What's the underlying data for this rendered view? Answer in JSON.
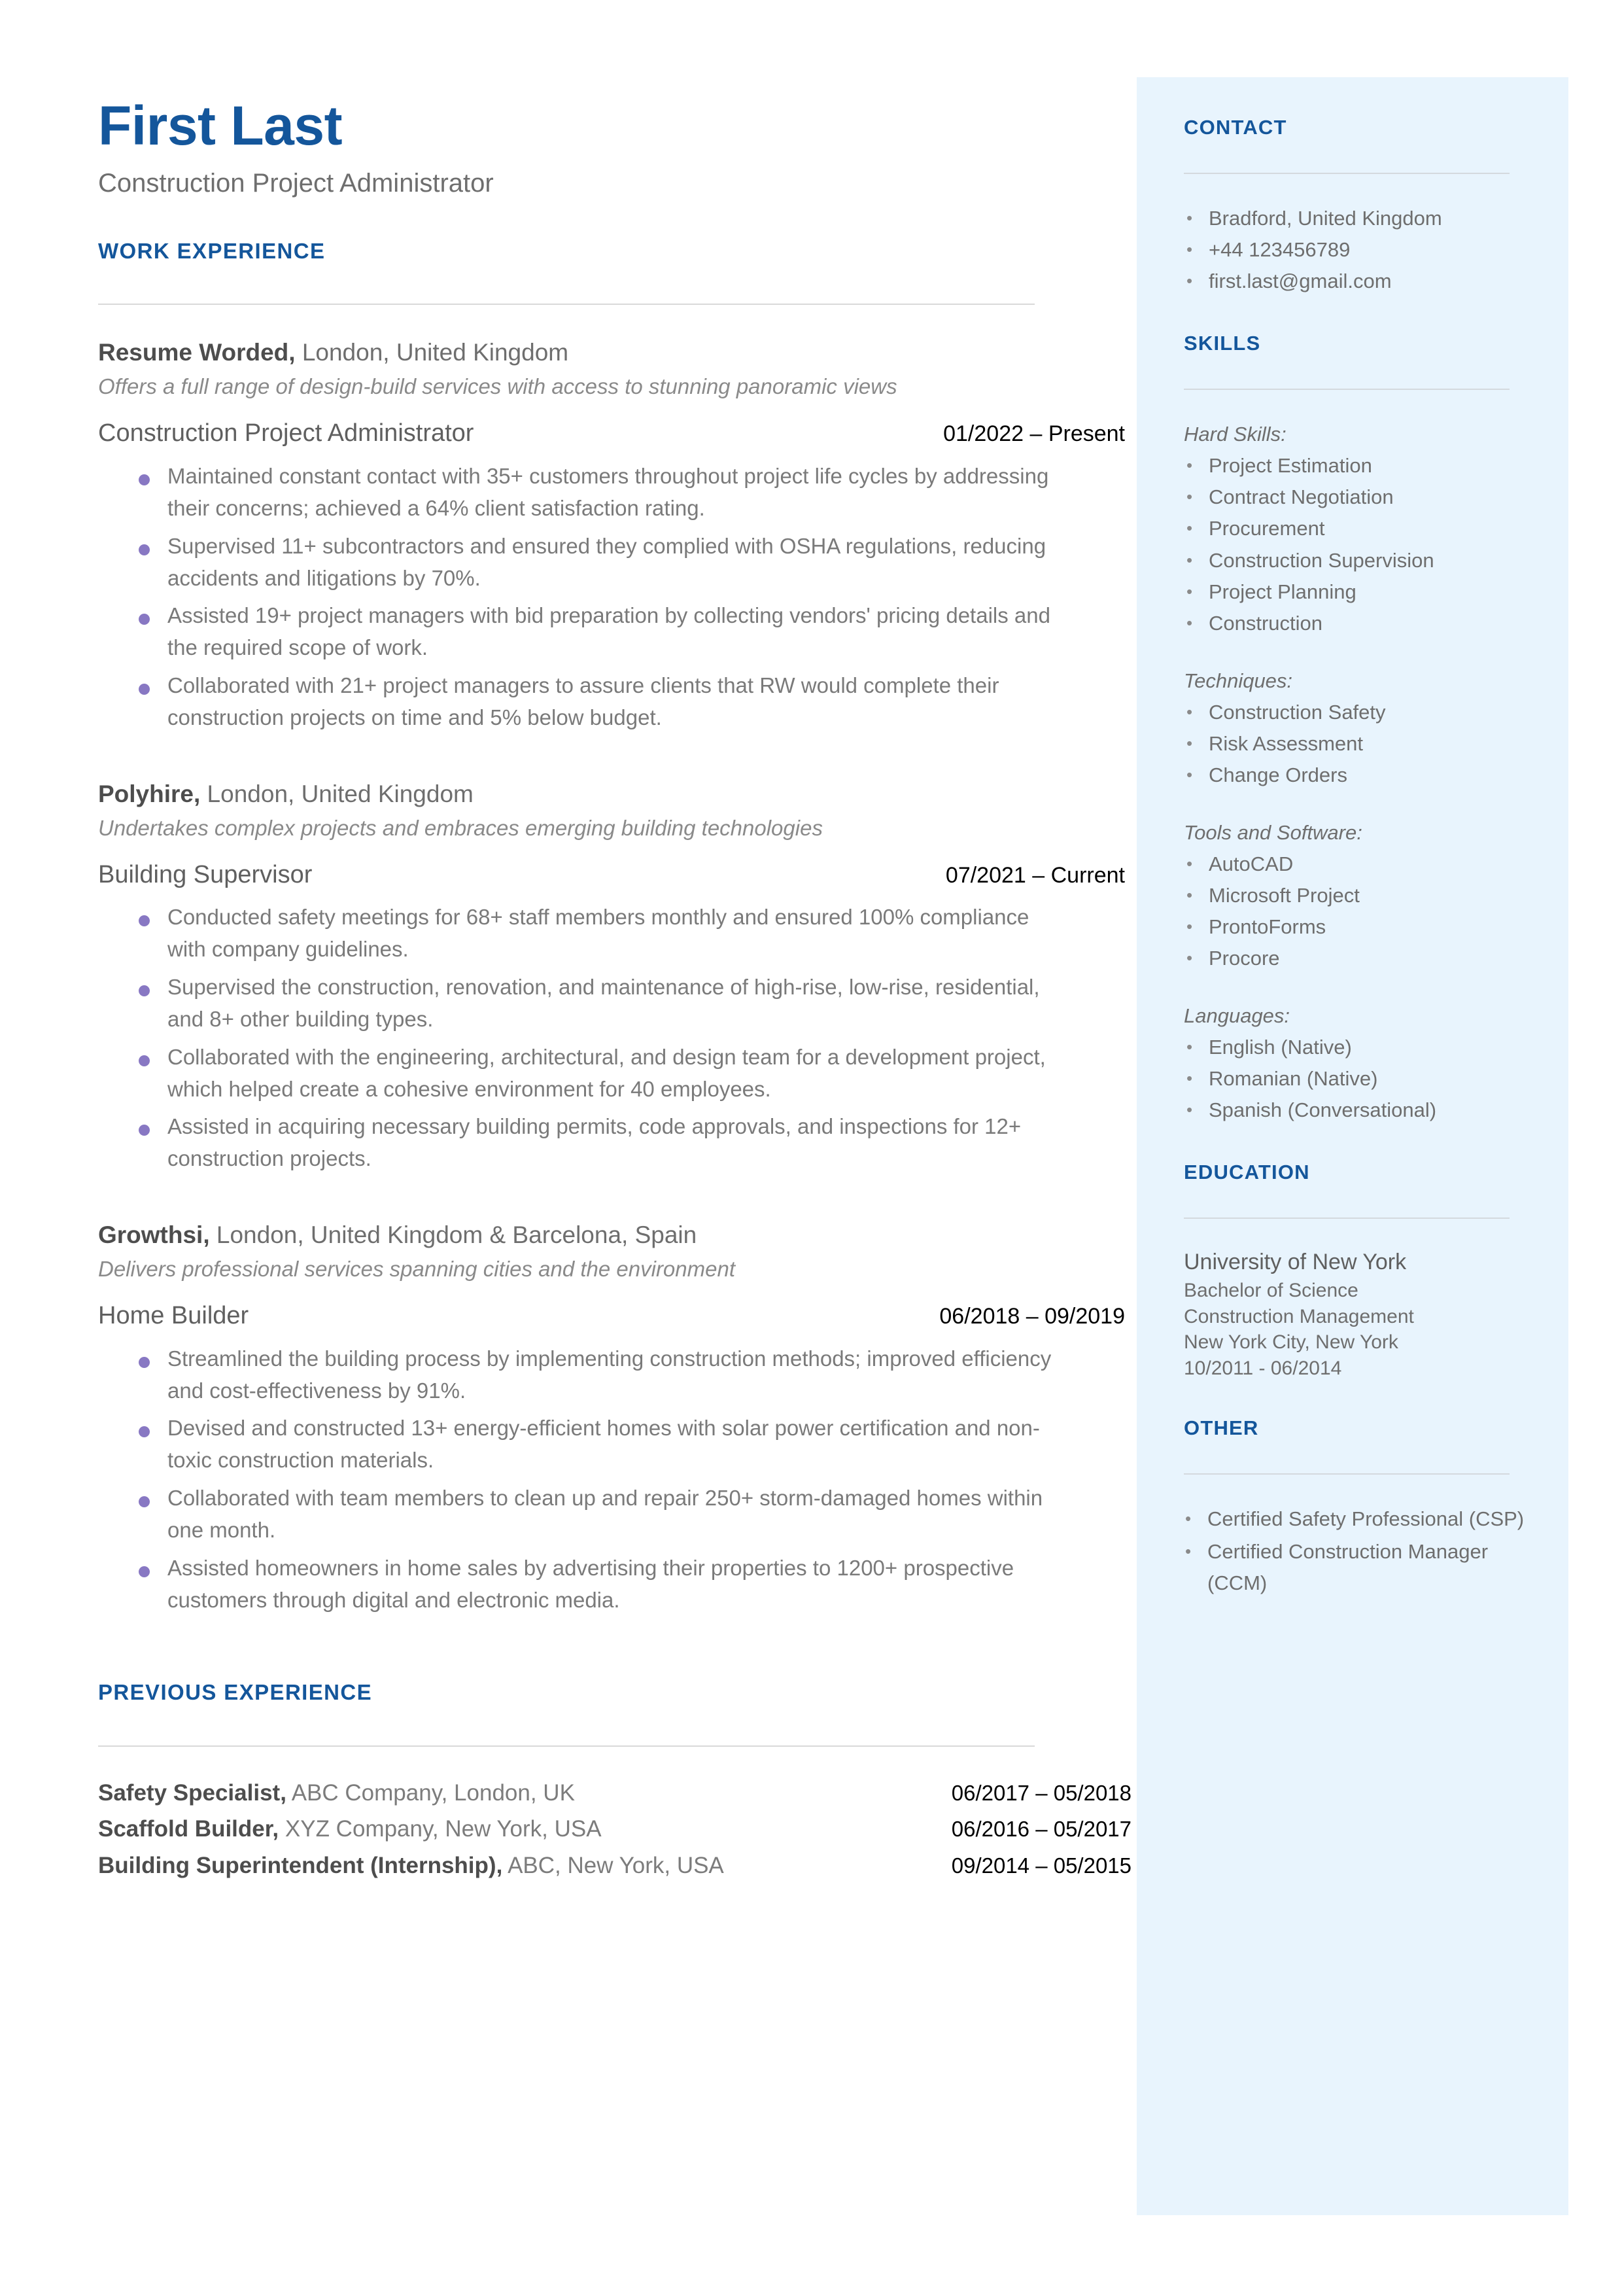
{
  "colors": {
    "accent_blue": "#14569b",
    "sidebar_bg": "#e8f4fd",
    "bullet_purple": "#8878c3",
    "body_gray": "#7a7a7a",
    "rule_gray": "#d9d9d9"
  },
  "header": {
    "name": "First Last",
    "headline": "Construction Project Administrator"
  },
  "work_experience": {
    "section_title": "WORK EXPERIENCE",
    "jobs": [
      {
        "company": "Resume Worded,",
        "location": " London, United Kingdom",
        "description": "Offers a full range of design-build services with access to stunning panoramic views",
        "role": "Construction Project Administrator",
        "dates": "01/2022 – Present",
        "bullets": [
          "Maintained constant contact with 35+ customers throughout project life cycles by addressing their concerns; achieved a 64% client satisfaction rating.",
          "Supervised 11+ subcontractors and ensured they complied with OSHA regulations, reducing accidents and litigations by 70%.",
          "Assisted 19+ project managers with bid preparation by collecting vendors' pricing details and the required scope of work.",
          "Collaborated with 21+ project managers to assure clients that RW would complete their construction projects on time and 5% below budget."
        ]
      },
      {
        "company": "Polyhire,",
        "location": " London, United Kingdom",
        "description": "Undertakes complex projects and embraces emerging building technologies",
        "role": "Building Supervisor",
        "dates": "07/2021 – Current",
        "bullets": [
          "Conducted safety meetings for 68+ staff members monthly and ensured 100% compliance with company guidelines.",
          "Supervised the construction, renovation, and maintenance of high-rise, low-rise, residential, and 8+ other building types.",
          "Collaborated with the engineering, architectural, and design team for a development project, which helped create a cohesive environment for 40 employees.",
          "Assisted in acquiring necessary building permits, code approvals, and inspections for 12+ construction projects."
        ]
      },
      {
        "company": "Growthsi,",
        "location": " London, United Kingdom & Barcelona, Spain",
        "description": "Delivers professional services spanning cities and the environment",
        "role": "Home Builder",
        "dates": "06/2018 – 09/2019",
        "bullets": [
          "Streamlined the building process by implementing construction methods; improved efficiency and cost-effectiveness by 91%.",
          "Devised and constructed 13+ energy-efficient homes with solar power certification and non-toxic construction materials.",
          "Collaborated with team members to clean up and repair 250+ storm-damaged homes within one month.",
          "Assisted homeowners in home sales by advertising their properties to 1200+ prospective customers through digital and electronic media."
        ]
      }
    ]
  },
  "previous_experience": {
    "section_title": "PREVIOUS EXPERIENCE",
    "rows": [
      {
        "title": "Safety Specialist,",
        "detail": " ABC Company, London, UK",
        "dates": "06/2017 – 05/2018"
      },
      {
        "title": "Scaffold Builder,",
        "detail": " XYZ Company, New York, USA",
        "dates": "06/2016 – 05/2017"
      },
      {
        "title": "Building Superintendent (Internship),",
        "detail": " ABC, New York, USA",
        "dates": "09/2014 – 05/2015"
      }
    ]
  },
  "sidebar": {
    "contact": {
      "title": "CONTACT",
      "items": [
        "Bradford, United Kingdom",
        "+44 123456789",
        "first.last@gmail.com"
      ]
    },
    "skills": {
      "title": "SKILLS",
      "groups": [
        {
          "label": "Hard Skills:",
          "items": [
            "Project Estimation",
            "Contract Negotiation",
            "Procurement",
            "Construction Supervision",
            "Project Planning",
            "Construction"
          ]
        },
        {
          "label": "Techniques:",
          "items": [
            "Construction Safety",
            "Risk Assessment",
            "Change Orders"
          ]
        },
        {
          "label": "Tools and Software:",
          "items": [
            "AutoCAD",
            "Microsoft Project",
            "ProntoForms",
            "Procore"
          ]
        },
        {
          "label": "Languages:",
          "items": [
            "English (Native)",
            "Romanian (Native)",
            "Spanish (Conversational)"
          ]
        }
      ]
    },
    "education": {
      "title": "EDUCATION",
      "school": "University of New York",
      "degree": "Bachelor of Science",
      "field": "Construction Management",
      "location": "New York City, New York",
      "dates": "10/2011 - 06/2014"
    },
    "other": {
      "title": "OTHER",
      "items": [
        "Certified Safety Professional (CSP)",
        "Certified Construction Manager (CCM)"
      ]
    }
  }
}
